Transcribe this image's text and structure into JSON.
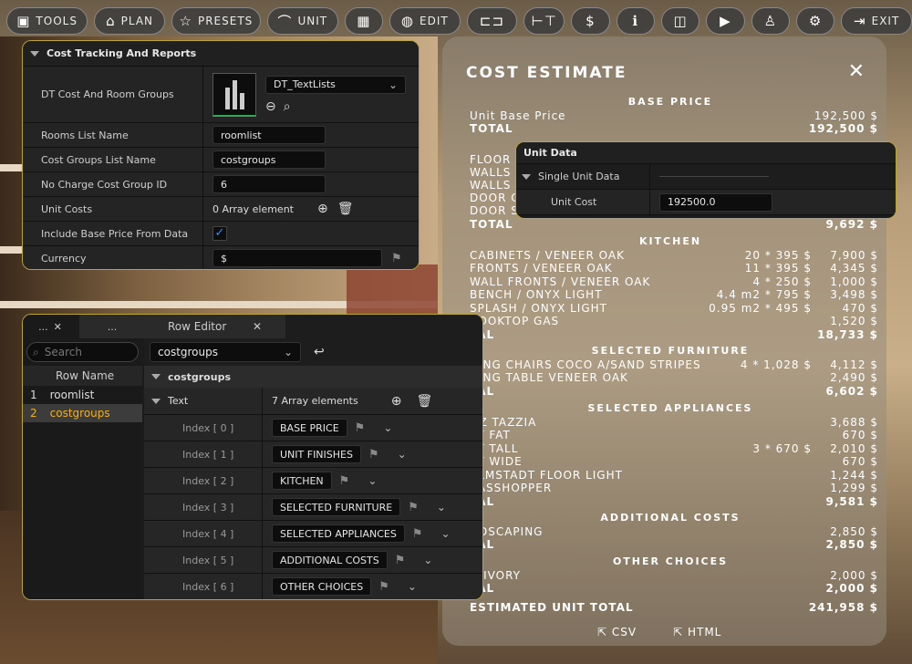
{
  "toolbar": {
    "items": [
      {
        "label": "TOOLS"
      },
      {
        "label": "PLAN"
      },
      {
        "label": "PRESETS"
      },
      {
        "label": "UNIT"
      },
      {
        "label": ""
      },
      {
        "label": "EDIT"
      },
      {
        "label": ""
      },
      {
        "label": ""
      },
      {
        "label": ""
      },
      {
        "label": ""
      },
      {
        "label": ""
      },
      {
        "label": ""
      },
      {
        "label": ""
      },
      {
        "label": ""
      },
      {
        "label": "EXIT"
      }
    ]
  },
  "cost_panel": {
    "title": "Cost Tracking And Reports",
    "dt_label": "DT Cost And Room Groups",
    "dt_value": "DT_TextLists",
    "rooms_label": "Rooms List Name",
    "rooms_value": "roomlist",
    "groups_label": "Cost Groups List Name",
    "groups_value": "costgroups",
    "nocharge_label": "No Charge Cost Group ID",
    "nocharge_value": "6",
    "unitcosts_label": "Unit Costs",
    "unitcosts_value": "0 Array element",
    "include_label": "Include Base Price From Data",
    "currency_label": "Currency",
    "currency_value": "$"
  },
  "unit_data": {
    "title": "Unit Data",
    "single_label": "Single Unit Data",
    "unit_cost_label": "Unit Cost",
    "unit_cost_value": "192500.0"
  },
  "row_editor": {
    "tab1": "...",
    "tab2": "...",
    "tab3": "Row Editor",
    "search_placeholder": "Search",
    "row_name_header": "Row Name",
    "rows": [
      {
        "num": "1",
        "name": "roomlist"
      },
      {
        "num": "2",
        "name": "costgroups"
      }
    ],
    "selected": "costgroups",
    "section": "costgroups",
    "text_label": "Text",
    "text_count": "7 Array elements",
    "indices": [
      {
        "label": "Index [ 0 ]",
        "value": "BASE PRICE"
      },
      {
        "label": "Index [ 1 ]",
        "value": "UNIT FINISHES"
      },
      {
        "label": "Index [ 2 ]",
        "value": "KITCHEN"
      },
      {
        "label": "Index [ 3 ]",
        "value": "SELECTED FURNITURE"
      },
      {
        "label": "Index [ 4 ]",
        "value": "SELECTED APPLIANCES"
      },
      {
        "label": "Index [ 5 ]",
        "value": "ADDITIONAL COSTS"
      },
      {
        "label": "Index [ 6 ]",
        "value": "OTHER CHOICES"
      }
    ]
  },
  "estimate": {
    "title": "COST ESTIMATE",
    "sections": {
      "base": "BASE PRICE",
      "kitchen": "KITCHEN",
      "furniture": "SELECTED FURNITURE",
      "appliances": "SELECTED APPLIANCES",
      "additional": "ADDITIONAL COSTS",
      "other": "OTHER CHOICES"
    },
    "lines": [
      {
        "n": "Unit Base Price",
        "q": "",
        "v": "192,500 $",
        "b": false
      },
      {
        "n": "TOTAL",
        "q": "",
        "v": "192,500 $",
        "b": true
      },
      {
        "n": "FLOOR /",
        "q": "",
        "v": "",
        "b": false
      },
      {
        "n": "WALLS IN",
        "q": "",
        "v": "",
        "b": false
      },
      {
        "n": "WALLS E",
        "q": "",
        "v": "",
        "b": false
      },
      {
        "n": "DOOR C",
        "q": "",
        "v": "",
        "b": false
      },
      {
        "n": "DOOR ST",
        "q": "",
        "v": "",
        "b": false
      },
      {
        "n": "TOTAL",
        "q": "",
        "v": "9,692 $",
        "b": true
      },
      {
        "n": "CABINETS / VENEER OAK",
        "q": "20  * 395 $",
        "v": "7,900 $",
        "b": false
      },
      {
        "n": "FRONTS / VENEER OAK",
        "q": "11  * 395 $",
        "v": "4,345 $",
        "b": false
      },
      {
        "n": "WALL FRONTS / VENEER OAK",
        "q": "4  * 250 $",
        "v": "1,000 $",
        "b": false
      },
      {
        "n": "BENCH / ONYX LIGHT",
        "q": "4.4 m2 * 795 $",
        "v": "3,498 $",
        "b": false
      },
      {
        "n": "SPLASH / ONYX LIGHT",
        "q": "0.95 m2 * 495 $",
        "v": "470 $",
        "b": false
      },
      {
        "n": "COOKTOP GAS",
        "q": "",
        "v": "1,520 $",
        "b": false
      },
      {
        "n": "TAL",
        "q": "",
        "v": "18,733 $",
        "b": true
      },
      {
        "n": "NING CHAIRS COCO A/SAND STRIPES",
        "q": "4  * 1,028 $",
        "v": "4,112 $",
        "b": false
      },
      {
        "n": "NING TABLE VENEER OAK",
        "q": "",
        "v": "2,490 $",
        "b": false
      },
      {
        "n": "TAL",
        "q": "",
        "v": "6,602 $",
        "b": true
      },
      {
        "n": "OZ TAZZIA",
        "q": "",
        "v": "3,688 $",
        "b": false
      },
      {
        "n": "AT FAT",
        "q": "",
        "v": "670 $",
        "b": false
      },
      {
        "n": "AT TALL",
        "q": "3  * 670 $",
        "v": "2,010 $",
        "b": false
      },
      {
        "n": "AT WIDE",
        "q": "",
        "v": "670 $",
        "b": false
      },
      {
        "n": "ALMSTADT FLOOR LIGHT",
        "q": "",
        "v": "1,244 $",
        "b": false
      },
      {
        "n": "RASSHOPPER",
        "q": "",
        "v": "1,299 $",
        "b": false
      },
      {
        "n": "TAL",
        "q": "",
        "v": "9,581 $",
        "b": true
      },
      {
        "n": "NDSCAPING",
        "q": "",
        "v": "2,850 $",
        "b": false
      },
      {
        "n": "TAL",
        "q": "",
        "v": "2,850 $",
        "b": true
      },
      {
        "n": "G IVORY",
        "q": "",
        "v": "2,000 $",
        "b": false
      },
      {
        "n": "TAL",
        "q": "",
        "v": "2,000 $",
        "b": true
      },
      {
        "n": "ESTIMATED UNIT TOTAL",
        "q": "",
        "v": "241,958 $",
        "b": true
      }
    ],
    "csv": "CSV",
    "html": "HTML"
  }
}
